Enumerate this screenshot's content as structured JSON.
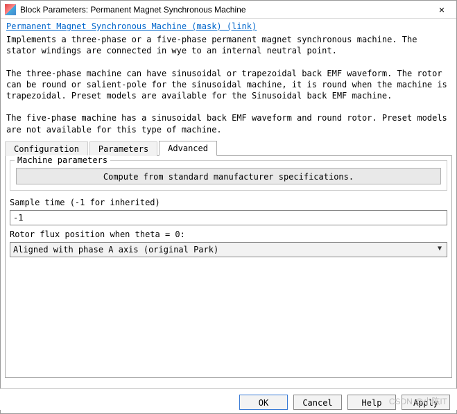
{
  "window": {
    "title": "Block Parameters: Permanent Magnet Synchronous Machine"
  },
  "mask_link": "Permanent Magnet Synchronous Machine (mask) (link)",
  "description": "Implements a three-phase or a five-phase permanent magnet synchronous machine. The stator windings are connected in wye to an internal neutral point.\n\nThe three-phase machine can have sinusoidal or trapezoidal back EMF waveform. The rotor can be round or salient-pole for the sinusoidal machine, it is round when the machine is trapezoidal. Preset models are available for the Sinusoidal back EMF machine.\n\nThe five-phase machine has a sinusoidal back EMF waveform and round rotor. Preset models are not available for this type of machine.",
  "tabs": {
    "configuration": "Configuration",
    "parameters": "Parameters",
    "advanced": "Advanced",
    "active": "advanced"
  },
  "advanced": {
    "group_title": "Machine parameters",
    "compute_btn": "Compute from standard manufacturer specifications.",
    "sample_time_label": "Sample time (-1 for inherited)",
    "sample_time_value": "-1",
    "rotor_flux_label": "Rotor flux position when theta = 0:",
    "rotor_flux_value": "Aligned with phase A axis (original Park)"
  },
  "buttons": {
    "ok": "OK",
    "cancel": "Cancel",
    "help": "Help",
    "apply": "Apply"
  },
  "watermark": "CSDN @小陈IT"
}
